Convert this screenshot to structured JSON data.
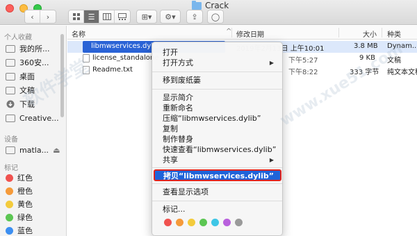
{
  "window": {
    "title": "Crack",
    "colors": {
      "close": "#fc605c",
      "minimize": "#fdbc40",
      "zoom": "#34c84a"
    }
  },
  "toolbar": {
    "back": "‹",
    "forward": "›",
    "view_icon": "☰",
    "arrange": "⊞▾",
    "action": "⚙▾",
    "share": "⇪",
    "tag": "◯"
  },
  "sidebar": {
    "favorites_header": "个人收藏",
    "favorites": [
      {
        "label": "我的所...",
        "icon": "documents-icon"
      },
      {
        "label": "360安...",
        "icon": "folder-icon"
      },
      {
        "label": "桌面",
        "icon": "desktop-icon"
      },
      {
        "label": "文稿",
        "icon": "documents-icon"
      },
      {
        "label": "下载",
        "icon": "download-icon"
      },
      {
        "label": "Creative...",
        "icon": "folder-icon"
      }
    ],
    "devices_header": "设备",
    "devices": [
      {
        "label": "matla...",
        "icon": "disk-icon",
        "eject": "⏏"
      }
    ],
    "tags_header": "标记",
    "tags": [
      {
        "label": "红色",
        "color": "#f0524f"
      },
      {
        "label": "橙色",
        "color": "#f59a3a"
      },
      {
        "label": "黄色",
        "color": "#f3cb3c"
      },
      {
        "label": "绿色",
        "color": "#5cc653"
      },
      {
        "label": "蓝色",
        "color": "#3d8ff1"
      }
    ]
  },
  "columns": {
    "name": "名称",
    "date": "修改日期",
    "size": "大小",
    "kind": "种类",
    "sort_indicator": "^"
  },
  "files": [
    {
      "name": "libmwservices.dylib",
      "date": "2019年2月13日 上午10:01",
      "size": "3.8 MB",
      "kind": "Dynam...ry"
    },
    {
      "name": "license_standalone",
      "date": "下午5:27",
      "size": "9 KB",
      "kind": "文稿"
    },
    {
      "name": "Readme.txt",
      "date": "下午8:22",
      "size": "333 字节",
      "kind": "纯文本文稿"
    }
  ],
  "context_menu": {
    "open": "打开",
    "open_with": "打开方式",
    "trash": "移到废纸篓",
    "get_info": "显示简介",
    "rename": "重新命名",
    "compress": "压缩“libmwservices.dylib”",
    "duplicate": "复制",
    "make_alias": "制作替身",
    "quick_look": "快速查看“libmwservices.dylib”",
    "share": "共享",
    "copy": "拷贝“libmwservices.dylib”",
    "view_options": "查看显示选项",
    "tags": "标记...",
    "submenu_arrow": "▶",
    "tag_colors": [
      "#f0524f",
      "#f59a3a",
      "#f3cb3c",
      "#5cc653",
      "#3ec6e6",
      "#b960dd",
      "#9a9a9a"
    ]
  },
  "watermark": [
    "软件学堂",
    "www.xue51.com"
  ]
}
